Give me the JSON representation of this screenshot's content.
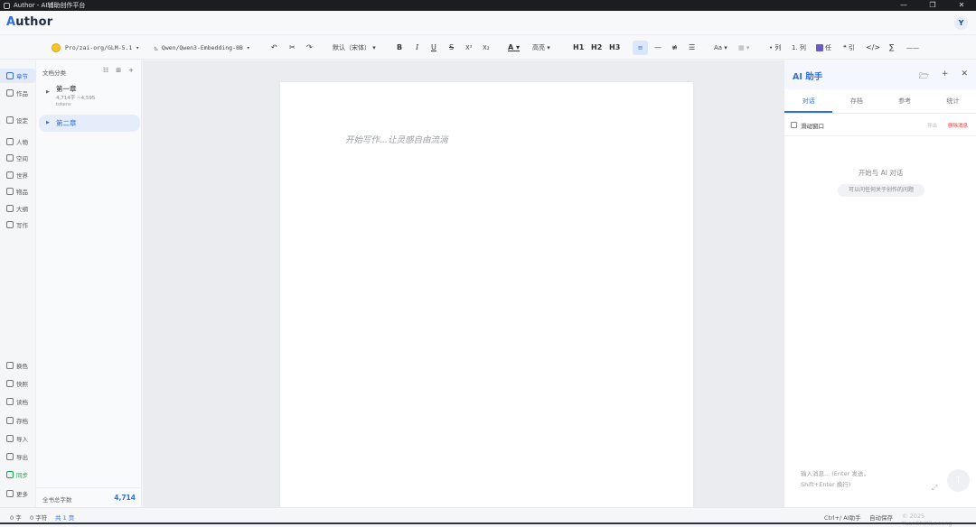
{
  "window": {
    "title": "Author - AI辅助创作平台",
    "controls": [
      "—",
      "❐",
      "✕"
    ]
  },
  "brand": {
    "initial": "A",
    "rest": "uthor"
  },
  "user": {
    "avatar": "Y"
  },
  "toolbar": {
    "model": "Pro/zai-org/GLM-5.1",
    "embedding": "Qwen/Qwen3-Embedding-8B",
    "font": "默认（宋体）",
    "highlight": "高亮",
    "h1": "H1",
    "h2": "H2",
    "h3": "H3",
    "font_size": "Aa",
    "bullet": "• 列",
    "ordered": "1. 列",
    "task": "任",
    "quote": "❝ 引",
    "code": "</>",
    "formula": "∑",
    "hr": "——"
  },
  "nav": {
    "top": [
      {
        "label": "章节",
        "icon": "book-icon"
      },
      {
        "label": "作品",
        "icon": "file-icon"
      },
      {
        "label": "设定",
        "icon": "bars-icon"
      },
      {
        "label": "人物",
        "icon": "user-icon"
      },
      {
        "label": "空间",
        "icon": "pin-icon"
      },
      {
        "label": "世界",
        "icon": "globe-icon"
      },
      {
        "label": "物品",
        "icon": "gem-icon"
      },
      {
        "label": "大纲",
        "icon": "clipboard-icon"
      },
      {
        "label": "写作",
        "icon": "pen-icon"
      }
    ],
    "bottom": [
      {
        "label": "换色",
        "icon": "moon-icon"
      },
      {
        "label": "快照",
        "icon": "history-icon"
      },
      {
        "label": "读档",
        "icon": "folder-icon"
      },
      {
        "label": "存档",
        "icon": "save-icon"
      },
      {
        "label": "导入",
        "icon": "import-icon"
      },
      {
        "label": "导出",
        "icon": "export-icon"
      },
      {
        "label": "同步",
        "icon": "cloud-icon"
      },
      {
        "label": "更多",
        "icon": "gear-icon"
      }
    ]
  },
  "chapters": {
    "header": "文档分类",
    "items": [
      {
        "title": "第一章",
        "meta": "4,714字 ~4,595",
        "meta2": "tokens"
      },
      {
        "title": "第二章"
      }
    ],
    "footer_label": "全书总字数",
    "footer_value": "4,714"
  },
  "editor": {
    "placeholder": "开始写作...让灵感自由流淌"
  },
  "ai": {
    "title": "AI 助手",
    "tabs": [
      "对话",
      "存档",
      "参考",
      "统计"
    ],
    "checkbox_label": "滑动窗口",
    "export": "导出",
    "clear": "删除消息",
    "empty_title": "开始与 AI 对话",
    "empty_hint": "可以问任何关于创作的问题",
    "input_placeholder": "输入消息... (Enter 发送，Shift+Enter 换行)"
  },
  "status": {
    "chars": "0 字",
    "chars2": "0 字符",
    "total": "共 1 页",
    "shortcut": "Ctrl+/ AI助手",
    "autosave": "自动保存",
    "copyright": "© 2025 YuanShiXiLaoong"
  }
}
